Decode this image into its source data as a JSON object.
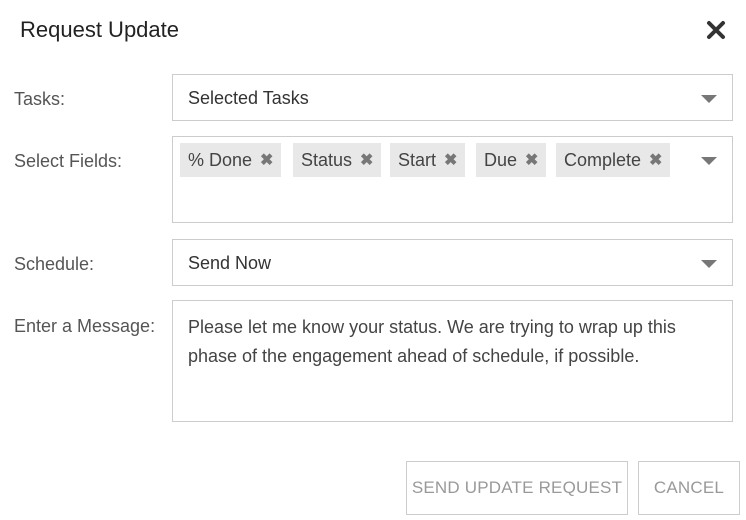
{
  "dialog": {
    "title": "Request Update"
  },
  "form": {
    "tasks": {
      "label": "Tasks:",
      "value": "Selected Tasks"
    },
    "fields": {
      "label": "Select Fields:",
      "chips": [
        "% Done",
        "Status",
        "Start",
        "Due",
        "Complete"
      ]
    },
    "schedule": {
      "label": "Schedule:",
      "value": "Send Now"
    },
    "message": {
      "label": "Enter a Message:",
      "value": "Please let me know your status. We are trying to wrap up this phase of the engagement ahead of schedule, if possible."
    }
  },
  "actions": {
    "send": "SEND UPDATE REQUEST",
    "cancel": "CANCEL"
  },
  "icons": {
    "close": "close-icon",
    "remove": "remove-chip-icon",
    "caret": "chevron-down-icon"
  },
  "colors": {
    "border": "#cccccc",
    "chip_bg": "#e8e8e8",
    "button_text": "#999999"
  }
}
